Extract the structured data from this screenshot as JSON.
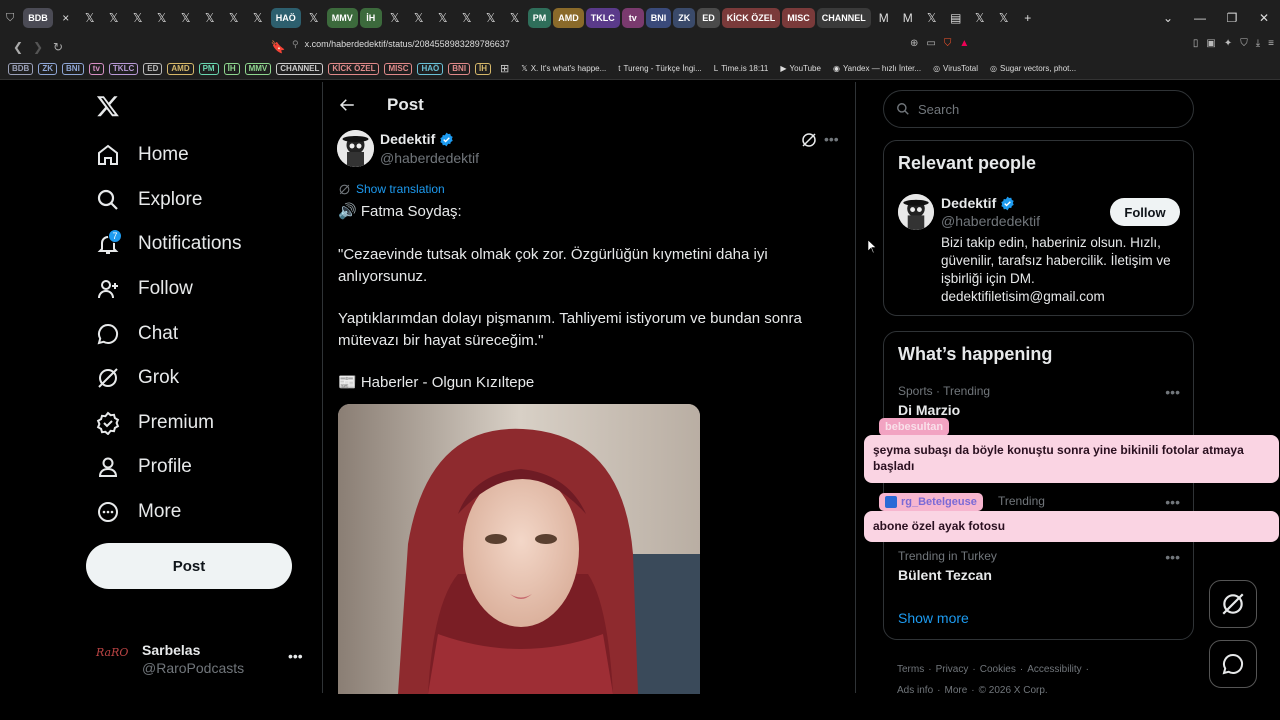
{
  "browser": {
    "tabs": [
      {
        "label": "BDB",
        "color": "#4b4b55",
        "active": true
      },
      {
        "label": "×",
        "x": true
      },
      {
        "label": "𝕏",
        "x": true
      },
      {
        "label": "𝕏",
        "x": true
      },
      {
        "label": "𝕏",
        "x": true
      },
      {
        "label": "𝕏",
        "x": true
      },
      {
        "label": "𝕏",
        "x": true
      },
      {
        "label": "𝕏",
        "x": true
      },
      {
        "label": "𝕏",
        "x": true
      },
      {
        "label": "𝕏",
        "x": true
      },
      {
        "label": "HAÖ",
        "color": "#2d5f6e"
      },
      {
        "label": "𝕏",
        "x": true
      },
      {
        "label": "MMV",
        "color": "#3c6a3c"
      },
      {
        "label": "İH",
        "color": "#3c6a3c"
      },
      {
        "label": "𝕏",
        "x": true
      },
      {
        "label": "𝕏",
        "x": true
      },
      {
        "label": "𝕏",
        "x": true
      },
      {
        "label": "𝕏",
        "x": true
      },
      {
        "label": "𝕏",
        "x": true
      },
      {
        "label": "𝕏",
        "x": true
      },
      {
        "label": "PM",
        "color": "#2f6e5a"
      },
      {
        "label": "AMD",
        "color": "#8a6a2a"
      },
      {
        "label": "TKLC",
        "color": "#5a3a8a"
      },
      {
        "label": "tv",
        "color": "#7a3a6e"
      },
      {
        "label": "BNI",
        "color": "#3a4a7a"
      },
      {
        "label": "ZK",
        "color": "#3a4a6a"
      },
      {
        "label": "ED",
        "color": "#4a4a4a"
      },
      {
        "label": "KİCK ÖZEL",
        "color": "#7a3a3a"
      },
      {
        "label": "MISC",
        "color": "#7a3a3a"
      },
      {
        "label": "CHANNEL",
        "color": "#3a3a3a"
      },
      {
        "label": "M",
        "x": true
      },
      {
        "label": "M",
        "x": true
      },
      {
        "label": "𝕏",
        "x": true
      },
      {
        "label": "▤",
        "x": true
      },
      {
        "label": "𝕏",
        "x": true
      },
      {
        "label": "𝕏",
        "x": true
      },
      {
        "label": "+",
        "x": true
      }
    ],
    "url": "x.com/haberdedektif/status/2084558983289786637",
    "bookmarks_groups": [
      {
        "label": "BDB",
        "color": "#9aa0b8"
      },
      {
        "label": "ZK",
        "color": "#8fa6d6"
      },
      {
        "label": "BNI",
        "color": "#8fa6d6"
      },
      {
        "label": "tv",
        "color": "#d68fc4"
      },
      {
        "label": "TKLC",
        "color": "#b89ad6"
      },
      {
        "label": "ED",
        "color": "#bbbbbb"
      },
      {
        "label": "AMD",
        "color": "#d6b86a"
      },
      {
        "label": "PM",
        "color": "#6ad6b0"
      },
      {
        "label": "İH",
        "color": "#8fd68f"
      },
      {
        "label": "MMV",
        "color": "#8fd68f"
      },
      {
        "label": "CHANNEL",
        "color": "#cccccc"
      },
      {
        "label": "KİCK ÖZEL",
        "color": "#e08a8a"
      },
      {
        "label": "MISC",
        "color": "#e08a8a"
      },
      {
        "label": "HAÖ",
        "color": "#6ac0d6"
      },
      {
        "label": "BNI",
        "color": "#e08a8a"
      },
      {
        "label": "İH",
        "color": "#d6b86a"
      }
    ],
    "bookmarks_links": [
      {
        "icon": "𝕏",
        "label": "X. It's what's happe..."
      },
      {
        "icon": "t",
        "label": "Tureng - Türkçe İngi..."
      },
      {
        "icon": "L",
        "label": "Time.is 18:11"
      },
      {
        "icon": "▶",
        "label": "YouTube"
      },
      {
        "icon": "◉",
        "label": "Yandex — hızlı İnter..."
      },
      {
        "icon": "◎",
        "label": "VirusTotal"
      },
      {
        "icon": "◎",
        "label": "Sugar vectors, phot..."
      }
    ]
  },
  "nav": {
    "items": [
      {
        "label": "Home",
        "icon": "home-icon"
      },
      {
        "label": "Explore",
        "icon": "search-icon"
      },
      {
        "label": "Notifications",
        "icon": "bell-icon"
      },
      {
        "label": "Follow",
        "icon": "person-add-icon"
      },
      {
        "label": "Chat",
        "icon": "chat-icon"
      },
      {
        "label": "Grok",
        "icon": "grok-icon"
      },
      {
        "label": "Premium",
        "icon": "premium-icon"
      },
      {
        "label": "Profile",
        "icon": "person-icon"
      },
      {
        "label": "More",
        "icon": "more-circle-icon"
      }
    ],
    "notif_count": "7",
    "post_label": "Post"
  },
  "account": {
    "name": "Sarbelas",
    "handle": "@RaroPodcasts",
    "avatar_text": "RaRO"
  },
  "main": {
    "header": "Post",
    "author_name": "Dedektif",
    "author_handle": "@haberdedektif",
    "show_translation": "Show translation",
    "text_lines": [
      "🔊 Fatma Soydaş:",
      "\"Cezaevinde tutsak olmak çok zor. Özgürlüğün kıymetini daha iyi anlıyorsunuz.",
      "Yaptıklarımdan dolayı pişmanım. Tahliyemi istiyorum ve bundan sonra mütevazı bir hayat süreceğim.\"",
      "📰 Haberler - Olgun Kızıltepe"
    ]
  },
  "search": {
    "placeholder": "Search"
  },
  "relevant": {
    "title": "Relevant people",
    "name": "Dedektif",
    "handle": "@haberdedektif",
    "follow": "Follow",
    "bio": "Bizi takip edin, haberiniz olsun. Hızlı, güvenilir, tarafsız habercilik. İletişim ve işbirliği için DM. dedektifiletisim@gmail.com"
  },
  "happening": {
    "title": "What’s happening",
    "trends": [
      {
        "category": "Sports · Trending",
        "name": "Di Marzio"
      },
      {
        "category": "Trending",
        "name": ""
      },
      {
        "category": "Trending in Turkey",
        "name": "Bülent Tezcan"
      }
    ],
    "show_more": "Show more"
  },
  "footer": {
    "links": [
      "Terms",
      "Privacy",
      "Cookies",
      "Accessibility",
      "Ads info",
      "More",
      "© 2026 X Corp."
    ]
  },
  "overlays": [
    {
      "user": "bebesultan",
      "message": "şeyma subaşı da böyle konuştu sonra yine bikinili fotolar atmaya başladı"
    },
    {
      "user": "rg_Betelgeuse",
      "message": "abone özel ayak fotosu"
    }
  ]
}
